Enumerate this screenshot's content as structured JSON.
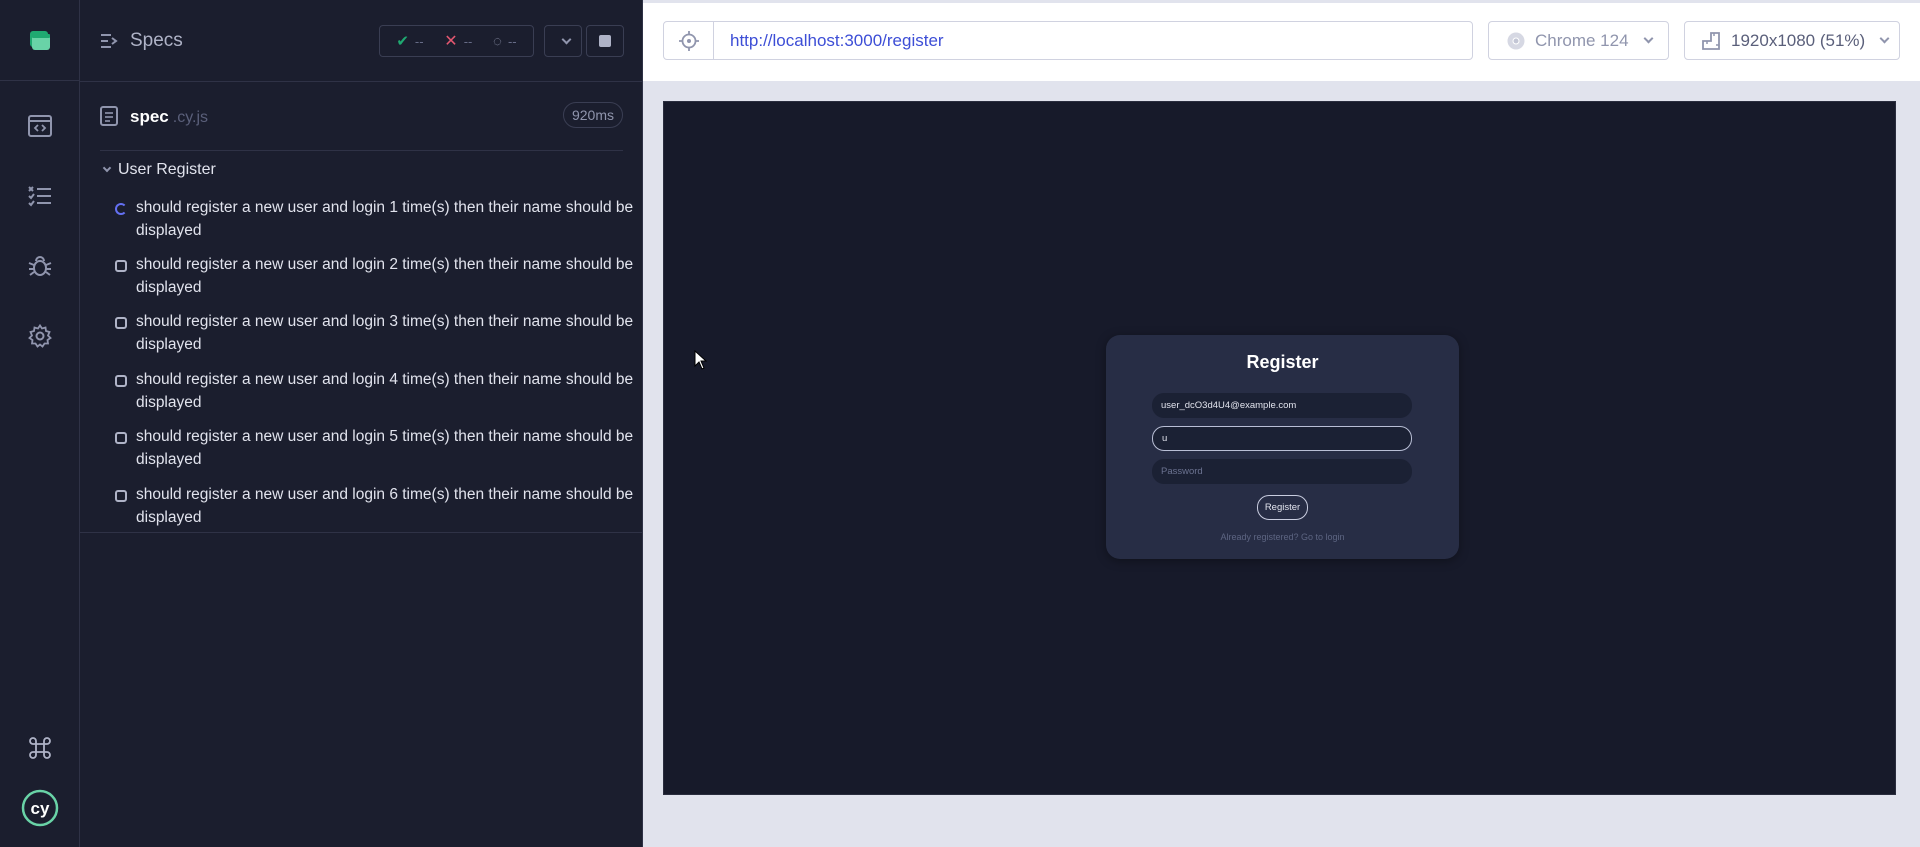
{
  "reporter": {
    "specs_label": "Specs",
    "stats": {
      "passed": "--",
      "failed": "--",
      "pending": "--"
    },
    "spec": {
      "name": "spec",
      "ext": ".cy.js",
      "duration": "920ms"
    },
    "suite": {
      "title": "User Register",
      "tests": [
        {
          "label": "should register a new user and login 1 time(s) then their name should be displayed",
          "state": "running"
        },
        {
          "label": "should register a new user and login 2 time(s) then their name should be displayed",
          "state": "queued"
        },
        {
          "label": "should register a new user and login 3 time(s) then their name should be displayed",
          "state": "queued"
        },
        {
          "label": "should register a new user and login 4 time(s) then their name should be displayed",
          "state": "queued"
        },
        {
          "label": "should register a new user and login 5 time(s) then their name should be displayed",
          "state": "queued"
        },
        {
          "label": "should register a new user and login 6 time(s) then their name should be displayed",
          "state": "queued"
        }
      ]
    }
  },
  "aut": {
    "url": "http://localhost:3000/register",
    "browser": "Chrome 124",
    "viewport": "1920x1080 (51%)"
  },
  "app": {
    "title": "Register",
    "email_value": "user_dcO3d4U4@example.com",
    "name_value": "u",
    "password_placeholder": "Password",
    "register_button": "Register",
    "login_link": "Already registered? Go to login"
  },
  "colors": {
    "accent": "#3d4ed6",
    "pass": "#1fa971",
    "fail": "#e45770",
    "running": "#6470f3",
    "cypress_teal": "#69d3a7"
  }
}
